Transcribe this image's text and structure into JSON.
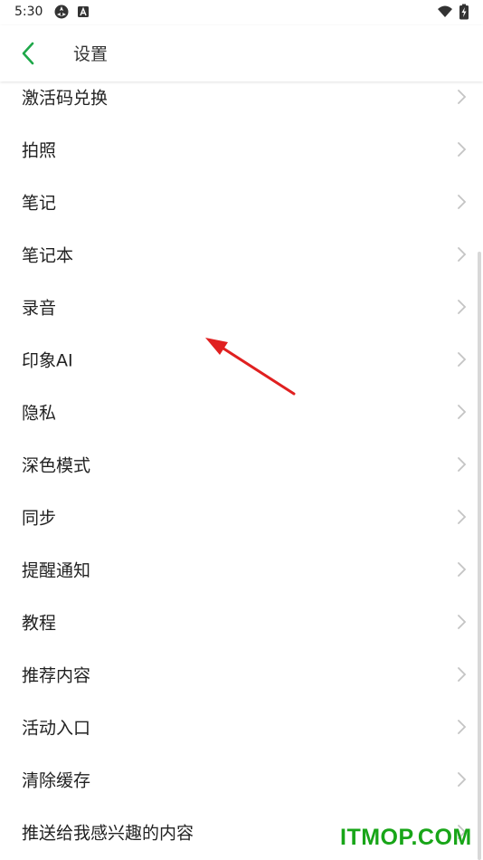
{
  "status_bar": {
    "time": "5:30",
    "icons": [
      "sync-icon",
      "a-notification-icon",
      "wifi-icon",
      "battery-charging-icon"
    ]
  },
  "header": {
    "back_icon": "chevron-left-icon",
    "title": "设置"
  },
  "settings": {
    "items": [
      {
        "label": "激活码兑换"
      },
      {
        "label": "拍照"
      },
      {
        "label": "笔记"
      },
      {
        "label": "笔记本"
      },
      {
        "label": "录音"
      },
      {
        "label": "印象AI"
      },
      {
        "label": "隐私"
      },
      {
        "label": "深色模式"
      },
      {
        "label": "同步"
      },
      {
        "label": "提醒通知"
      },
      {
        "label": "教程"
      },
      {
        "label": "推荐内容"
      },
      {
        "label": "活动入口"
      },
      {
        "label": "清除缓存"
      },
      {
        "label": "推送给我感兴趣的内容"
      }
    ],
    "chevron_icon": "chevron-right-icon"
  },
  "watermark": "ITMOP.COM",
  "colors": {
    "accent": "#1fa84a",
    "annotation_arrow": "#e02020",
    "watermark": "#18a518",
    "chevron": "#c4c4c4"
  }
}
